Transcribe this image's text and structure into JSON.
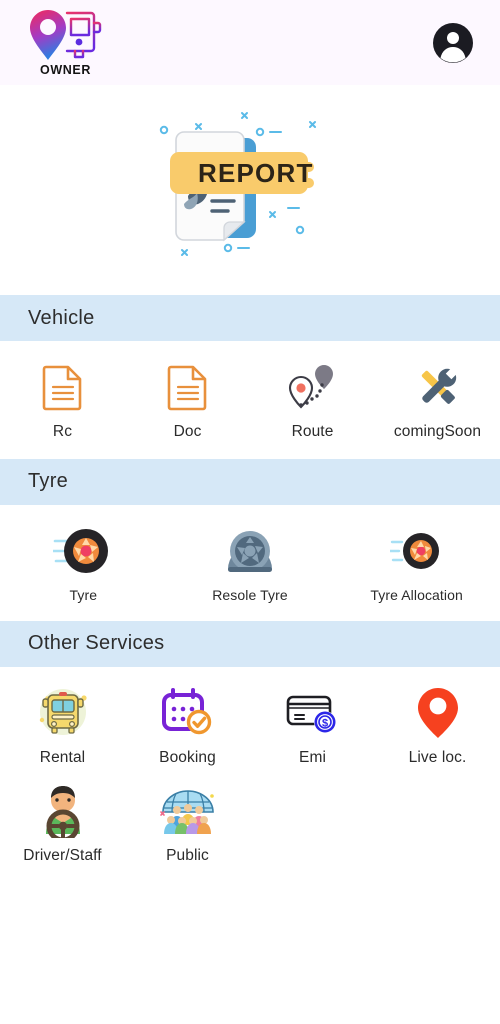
{
  "header": {
    "brand_name": "OWNER",
    "logo_icon": "location-pin-bus-logo",
    "avatar_icon": "account-circle-icon"
  },
  "hero": {
    "banner_text": "REPORT",
    "illustration": "report-document-illustration",
    "banner_color": "#f9cb6b",
    "document_accent": "#4a9ed4"
  },
  "sections": [
    {
      "title": "Vehicle",
      "columns": 4,
      "items": [
        {
          "label": "Rc",
          "icon": "document-orange-icon"
        },
        {
          "label": "Doc",
          "icon": "document-orange-icon"
        },
        {
          "label": "Route",
          "icon": "route-pins-icon"
        },
        {
          "label": "comingSoon",
          "icon": "wrench-screwdriver-icon"
        }
      ]
    },
    {
      "title": "Tyre",
      "columns": 3,
      "items": [
        {
          "label": "Tyre",
          "icon": "tyre-orange-rim-icon"
        },
        {
          "label": "Resole Tyre",
          "icon": "wheel-blue-gray-icon"
        },
        {
          "label": "Tyre Allocation",
          "icon": "tyre-orange-rim-small-icon"
        }
      ]
    },
    {
      "title": "Other Services",
      "columns": 4,
      "items": [
        {
          "label": "Rental",
          "icon": "bus-rental-icon"
        },
        {
          "label": "Booking",
          "icon": "calendar-check-icon"
        },
        {
          "label": "Emi",
          "icon": "credit-card-dollar-icon"
        },
        {
          "label": "Live loc.",
          "icon": "map-pin-orange-icon"
        },
        {
          "label": "Driver/Staff",
          "icon": "driver-steering-wheel-icon"
        },
        {
          "label": "Public",
          "icon": "people-globe-icon"
        }
      ]
    }
  ],
  "colors": {
    "section_header_bg": "#d6e8f7",
    "header_bg": "#fdf8ff",
    "icon_orange": "#e8903c",
    "accent_red": "#f6411f",
    "accent_purple": "#7823d6"
  }
}
